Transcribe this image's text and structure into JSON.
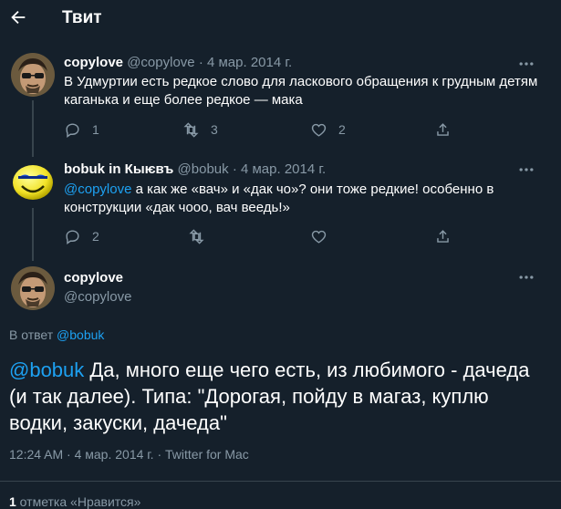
{
  "header": {
    "title": "Твит",
    "back_icon": "arrow-left-icon"
  },
  "tweets": [
    {
      "name": "copylove",
      "handle": "@copylove",
      "dot": "·",
      "date": "4 мар. 2014 г.",
      "text": "В Удмуртии есть редкое слово для ласкового обращения к грудным детям каганька и еще более редкое — мака",
      "reply_count": "1",
      "retweet_count": "3",
      "like_count": "2"
    },
    {
      "name": "bobuk in Кыѥвъ",
      "handle": "@bobuk",
      "dot": "·",
      "date": "4 мар. 2014 г.",
      "mention": "@copylove",
      "text": " а как же «вач» и «дак чо»? они тоже редкие! особенно в конструкции «дак чооо, вач веедь!»",
      "reply_count": "2"
    }
  ],
  "main": {
    "name": "copylove",
    "handle": "@copylove",
    "reply_to_label": "В ответ ",
    "reply_to_handle": "@bobuk",
    "mention": "@bobuk",
    "text": " Да, много еще чего есть, из любимого - дачеда (и так далее). Типа: \"Дорогая, пойду в магаз, куплю водки, закуски, дачеда\"",
    "timestamp": "12:24 AM · 4 мар. 2014 г. · Twitter for Mac",
    "like_count": "1",
    "like_label": " отметка «Нравится»"
  },
  "colors": {
    "background": "#15202b",
    "accent": "#1da1f2",
    "muted": "#8899a6",
    "border": "#38444d"
  }
}
